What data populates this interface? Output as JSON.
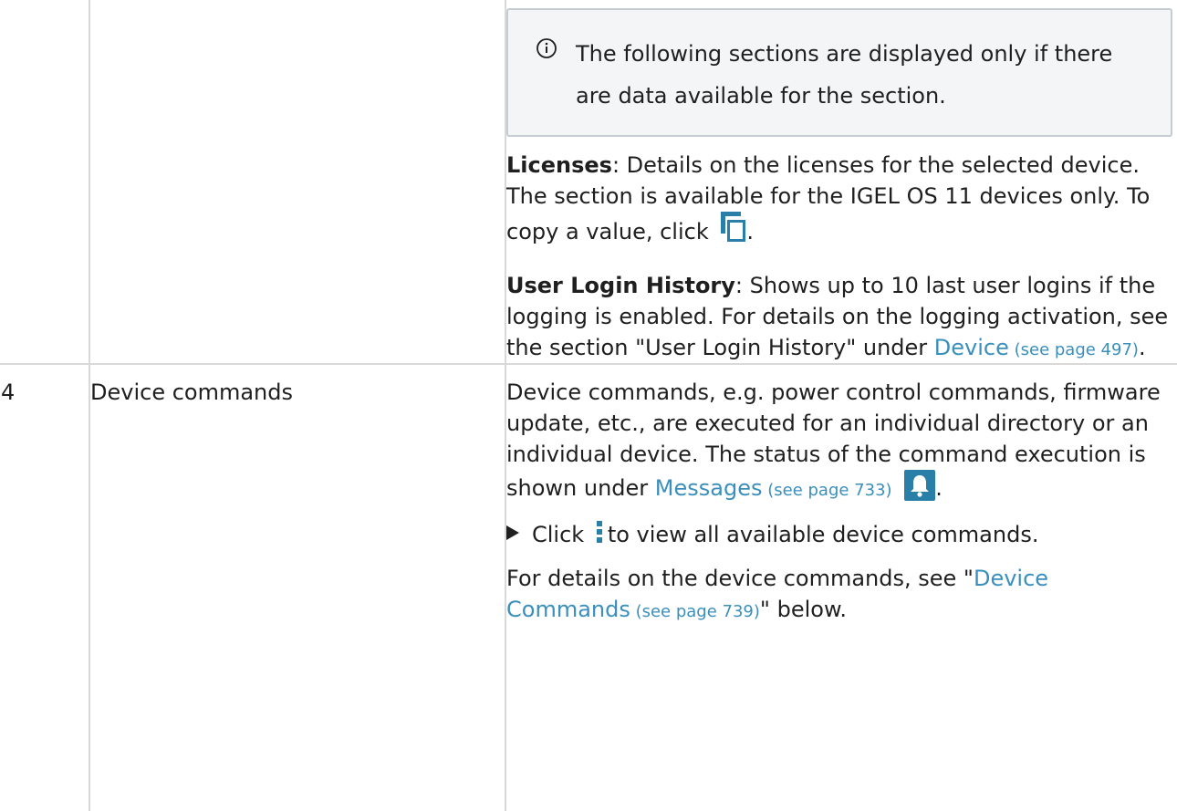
{
  "notice": {
    "icon": "info-circle-icon",
    "text": "The following sections are displayed only if there are data available for the section."
  },
  "licenses": {
    "label": "Licenses",
    "text1": ": Details on the licenses for the selected device. The section is available for the IGEL OS 11 devices only. To copy a value, click",
    "icon": "copy-icon",
    "text2": "."
  },
  "login_history": {
    "label": "User Login History",
    "text": ":  Shows up to 10 last user logins if the logging is enabled. For details on the logging activation, see the section \"User Login History\" under ",
    "link_text": "Device",
    "link_ref": " (see page 497)",
    "end": "."
  },
  "row4": {
    "number": "4",
    "name": "Device commands",
    "description1": "Device commands, e.g. power control commands, firmware update, etc., are executed for an individual directory or an individual device. The status of the command execution is shown under ",
    "messages_link": "Messages",
    "messages_ref": " (see page 733)",
    "bell_icon": "bell-icon",
    "period": ".",
    "step_icon": "triangle-bullet-icon",
    "step_text_before": "Click",
    "kebab_icon": "kebab-menu-icon",
    "step_text_after": "to view all available device commands.",
    "details_before": "For details on the device commands, see \"",
    "details_link": "Device Commands",
    "details_ref": " (see page 739)",
    "details_after": "\" below."
  },
  "colors": {
    "text": "#1f1f1f",
    "link": "#3a8fbd",
    "grid": "#d9d9d9",
    "notice_bg": "#f4f5f7",
    "notice_border": "#c5ccd4",
    "icon_blue": "#2a7fa8"
  }
}
